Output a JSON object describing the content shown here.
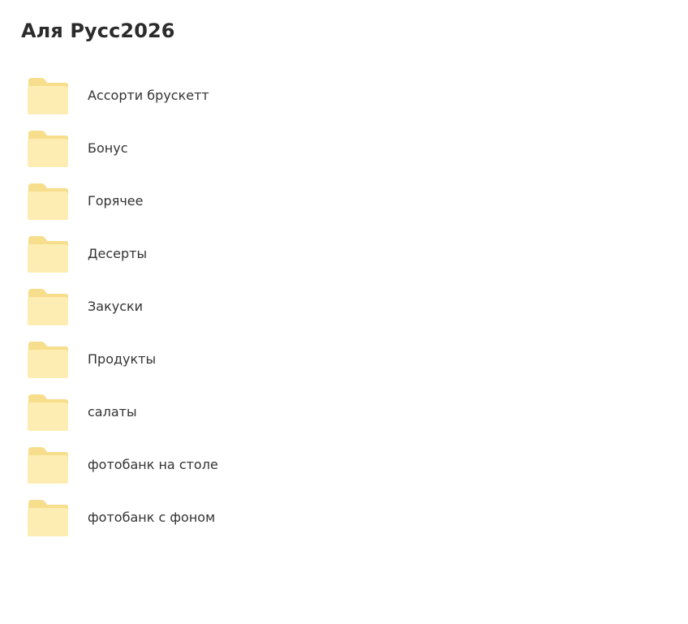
{
  "header": {
    "title": "Аля Русс2026"
  },
  "folders": [
    {
      "label": "Ассорти брускетт",
      "icon": "folder-icon"
    },
    {
      "label": "Бонус",
      "icon": "folder-icon"
    },
    {
      "label": "Горячее",
      "icon": "folder-icon"
    },
    {
      "label": "Десерты",
      "icon": "folder-icon"
    },
    {
      "label": "Закуски",
      "icon": "folder-icon"
    },
    {
      "label": "Продукты",
      "icon": "folder-icon"
    },
    {
      "label": "салаты",
      "icon": "folder-icon"
    },
    {
      "label": "фотобанк на столе",
      "icon": "folder-icon"
    },
    {
      "label": "фотобанк с фоном",
      "icon": "folder-icon"
    }
  ],
  "colors": {
    "folder_back": "#F7DE8C",
    "folder_front": "#FDEDB3",
    "title_text": "#2B2B2B",
    "item_text": "#333333"
  }
}
